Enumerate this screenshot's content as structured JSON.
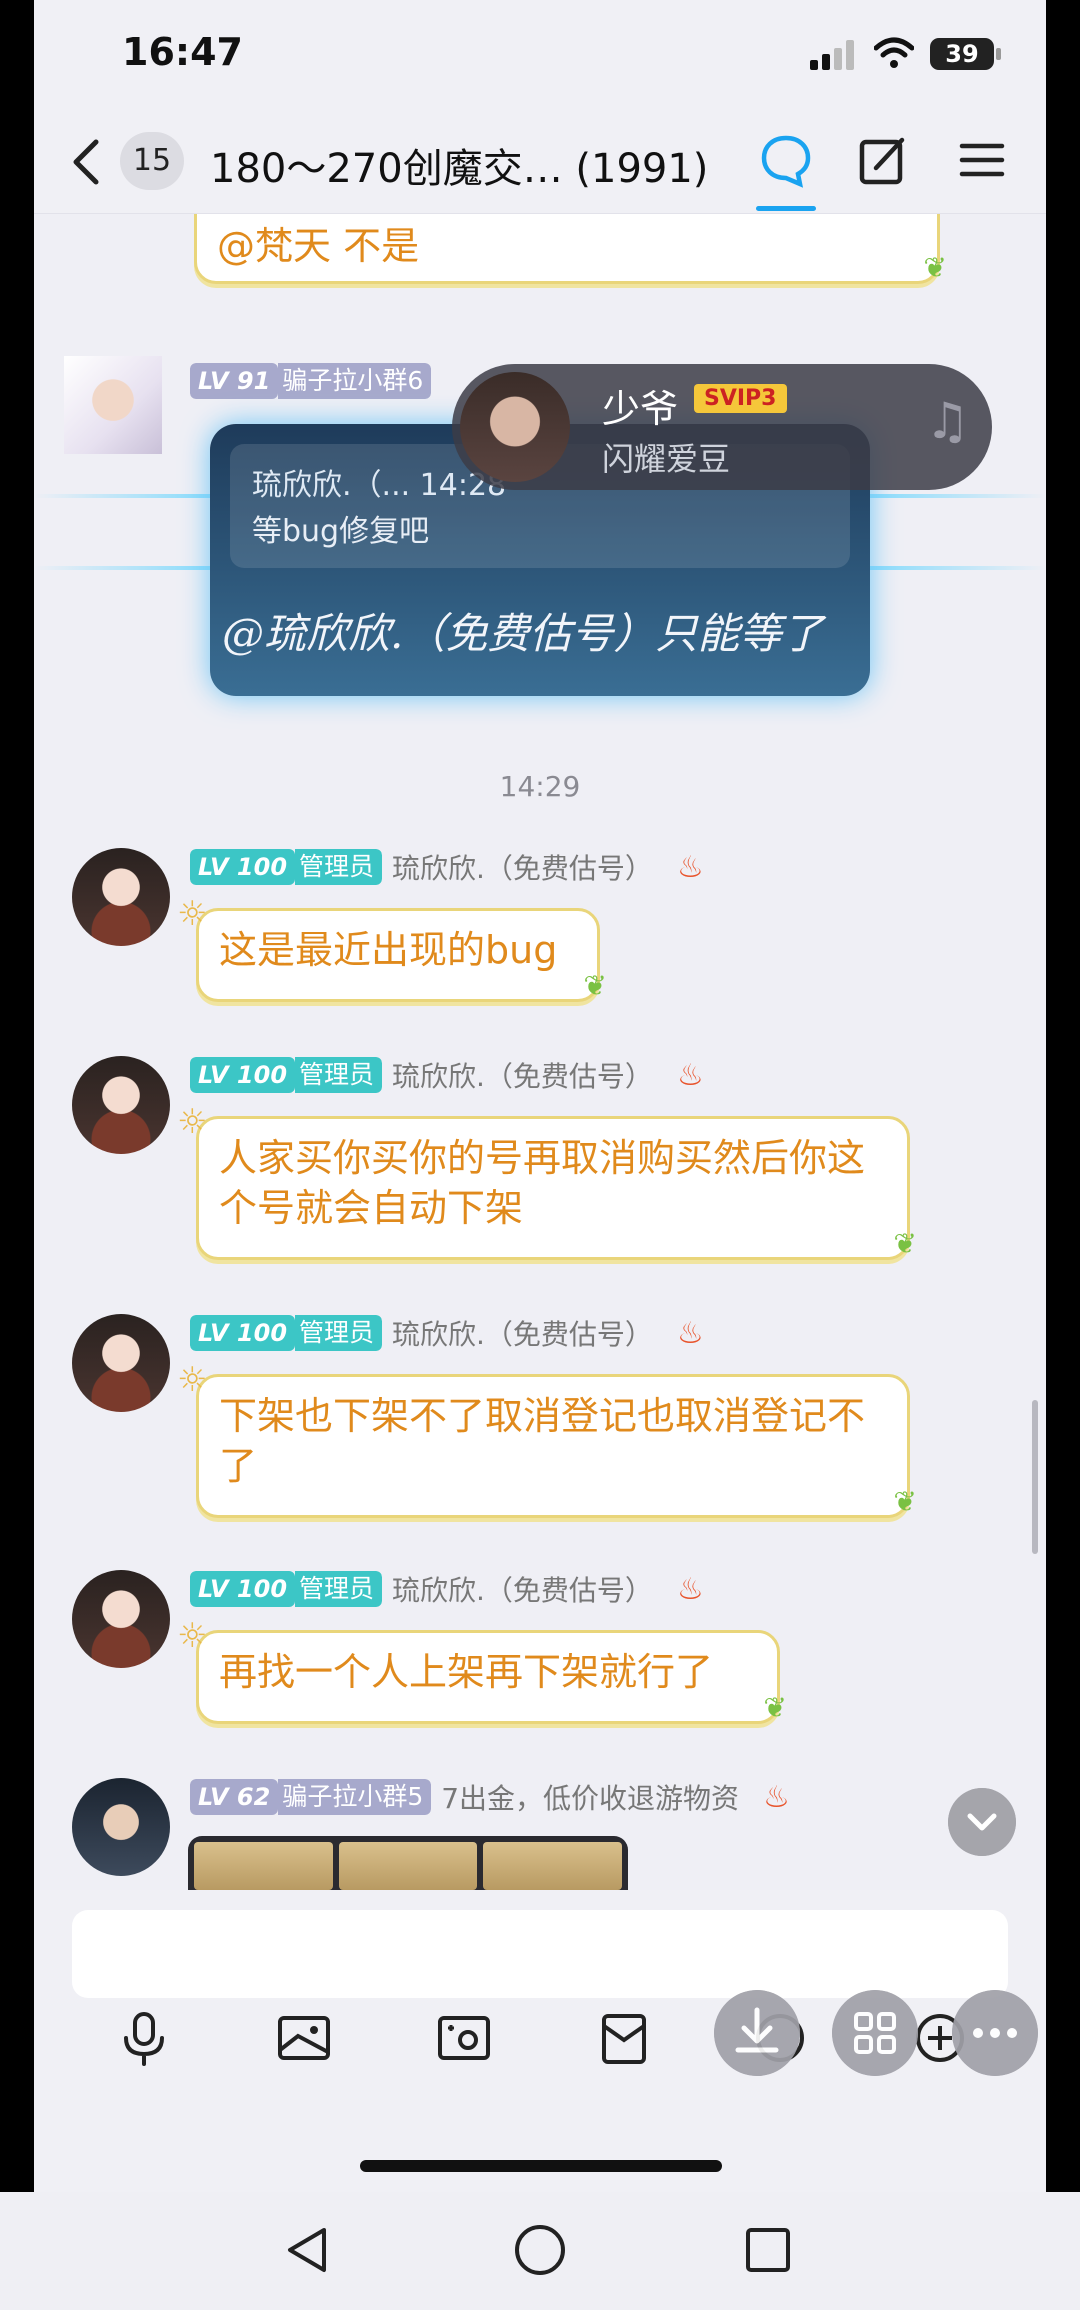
{
  "status": {
    "time": "16:47",
    "battery": "39"
  },
  "header": {
    "unread_count": "15",
    "title": "180～270创魔交… (1991)"
  },
  "chat": {
    "partial_bubble": "@梵天 不是",
    "card_message": {
      "level": "LV 91",
      "role": "骗子拉小群6",
      "quote_header": "琉欣欣.（... 14:28",
      "quote_body": "等bug修复吧",
      "text": "@琉欣欣.（免费估号）只能等了"
    },
    "music_card": {
      "name": "少爷",
      "vip": "SVIP3",
      "song": "闪耀爱豆"
    },
    "timestamp": "14:29",
    "messages": [
      {
        "level": "LV 100",
        "role": "管理员",
        "nick": "琉欣欣.（免费估号）",
        "text": "这是最近出现的bug"
      },
      {
        "level": "LV 100",
        "role": "管理员",
        "nick": "琉欣欣.（免费估号）",
        "text": "人家买你买你的号再取消购买然后你这个号就会自动下架"
      },
      {
        "level": "LV 100",
        "role": "管理员",
        "nick": "琉欣欣.（免费估号）",
        "text": "下架也下架不了取消登记也取消登记不了"
      },
      {
        "level": "LV 100",
        "role": "管理员",
        "nick": "琉欣欣.（免费估号）",
        "text": "再找一个人上架再下架就行了"
      }
    ],
    "last_sender": {
      "level": "LV 62",
      "role": "骗子拉小群5",
      "nick": "7出金，低价收退游物资"
    }
  },
  "colors": {
    "bubble_text": "#e08a1c",
    "admin_badge": "#3cc6c6",
    "member_badge": "#a7a9cc",
    "accent": "#1aa3f0"
  }
}
